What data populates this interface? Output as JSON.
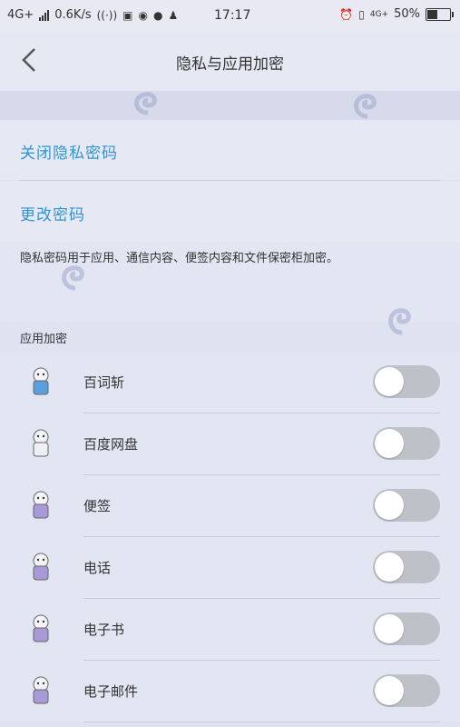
{
  "status_bar": {
    "network": "4G+",
    "speed": "0.6K/s",
    "time": "17:17",
    "network_right": "4G+",
    "battery": "50%"
  },
  "header": {
    "title": "隐私与应用加密"
  },
  "actions": {
    "close_privacy_password": "关闭隐私密码",
    "change_password": "更改密码"
  },
  "description": "隐私密码用于应用、通信内容、便签内容和文件保密柜加密。",
  "section": {
    "label": "应用加密"
  },
  "apps": [
    {
      "name": "百词斩",
      "enabled": false
    },
    {
      "name": "百度网盘",
      "enabled": false
    },
    {
      "name": "便签",
      "enabled": false
    },
    {
      "name": "电话",
      "enabled": false
    },
    {
      "name": "电子书",
      "enabled": false
    },
    {
      "name": "电子邮件",
      "enabled": false
    }
  ],
  "colors": {
    "link": "#2f95d4",
    "toggle_off": "#bfc1c8",
    "background": "#dfe2f0"
  }
}
